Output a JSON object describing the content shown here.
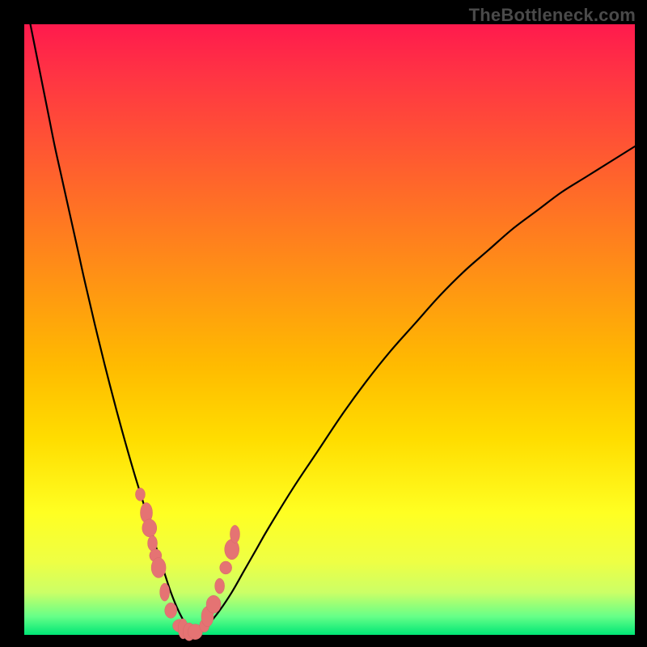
{
  "watermark": "TheBottleneck.com",
  "colors": {
    "frame_bg": "#000000",
    "curve_stroke": "#000000",
    "dot_fill": "#e57373",
    "dot_stroke": "#d46a6a"
  },
  "chart_data": {
    "type": "line",
    "title": "",
    "xlabel": "",
    "ylabel": "",
    "xlim": [
      0,
      100
    ],
    "ylim": [
      0,
      100
    ],
    "series": [
      {
        "name": "bottleneck-curve",
        "x": [
          1,
          2,
          3,
          4,
          5,
          6,
          7,
          8,
          9,
          10,
          12,
          14,
          16,
          18,
          20,
          21,
          22,
          23,
          24,
          25,
          26,
          27,
          28,
          29,
          30,
          32,
          34,
          36,
          38,
          40,
          44,
          48,
          52,
          56,
          60,
          64,
          68,
          72,
          76,
          80,
          84,
          88,
          92,
          96,
          100
        ],
        "values": [
          100,
          95,
          90,
          85,
          80,
          75.5,
          71,
          66.5,
          62,
          57.5,
          49,
          41,
          33.5,
          26.5,
          20,
          16.5,
          13,
          10,
          7,
          4.5,
          2.5,
          1,
          0.2,
          0.5,
          1.5,
          4,
          7,
          10.5,
          14,
          17.5,
          24,
          30,
          36,
          41.5,
          46.5,
          51,
          55.5,
          59.5,
          63,
          66.5,
          69.5,
          72.5,
          75,
          77.5,
          80
        ]
      }
    ],
    "annotations": {
      "scatter_dots": {
        "name": "highlighted-region",
        "x": [
          19,
          20,
          20.5,
          21,
          21.5,
          22,
          23,
          24,
          25.5,
          26,
          27,
          28,
          29.5,
          30,
          31,
          32,
          33,
          34,
          34.5
        ],
        "values": [
          23,
          20,
          17.5,
          15,
          13,
          11,
          7,
          4,
          1.5,
          1,
          0.5,
          0.5,
          1.5,
          3,
          5,
          8,
          11,
          14,
          16.5
        ]
      }
    }
  }
}
